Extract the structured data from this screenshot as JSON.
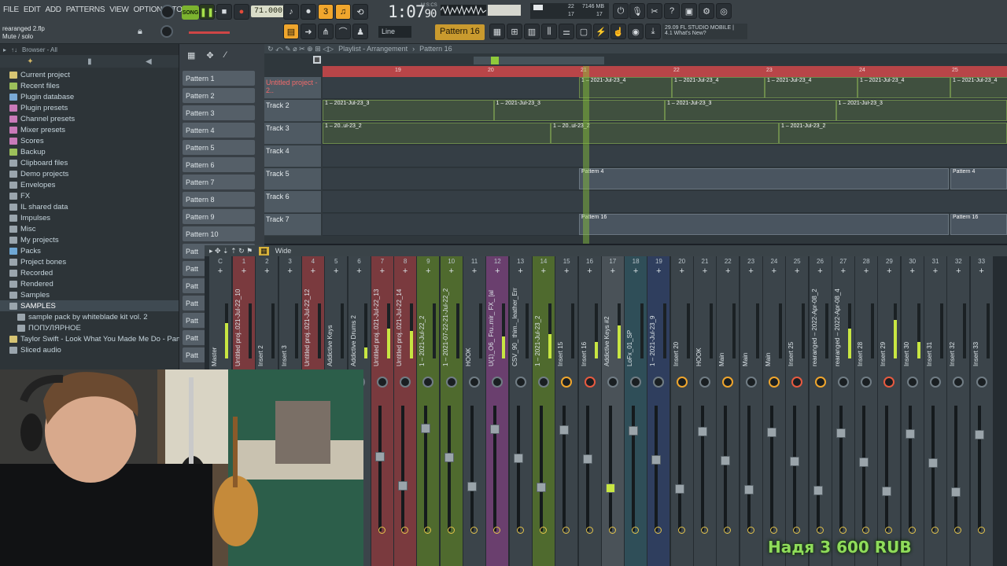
{
  "menu": [
    "FILE",
    "EDIT",
    "ADD",
    "PATTERNS",
    "VIEW",
    "OPTIONS",
    "TOOLS",
    "HELP"
  ],
  "transport": {
    "mode": "SONG",
    "tempo": "71.000",
    "time": "1:07",
    "time_sub": "90",
    "time_label": "M:S:CS",
    "cpu_top": "22",
    "cpu_bottom": "17",
    "ram": "7146 MB",
    "ram_sub": "17"
  },
  "hint": {
    "file": "rearanged 2.flp",
    "action": "Mute / solo"
  },
  "snap": "Line",
  "pattern_selector": "Pattern 16",
  "news": {
    "date": "29.09",
    "title": "FL STUDIO MOBILE |",
    "subtitle": "4.1 What's New?"
  },
  "browser": {
    "header": "Browser - All",
    "items": [
      {
        "label": "Current project",
        "color": "#d6c473"
      },
      {
        "label": "Recent files",
        "color": "#9cc05a"
      },
      {
        "label": "Plugin database",
        "color": "#7aa9d6"
      },
      {
        "label": "Plugin presets",
        "color": "#c97ab9"
      },
      {
        "label": "Channel presets",
        "color": "#c97ab9"
      },
      {
        "label": "Mixer presets",
        "color": "#c97ab9"
      },
      {
        "label": "Scores",
        "color": "#c97ab9"
      },
      {
        "label": "Backup",
        "color": "#9cc05a"
      },
      {
        "label": "Clipboard files",
        "color": "#9aa5ad"
      },
      {
        "label": "Demo projects",
        "color": "#9aa5ad"
      },
      {
        "label": "Envelopes",
        "color": "#9aa5ad"
      },
      {
        "label": "FX",
        "color": "#9aa5ad"
      },
      {
        "label": "IL shared data",
        "color": "#9aa5ad"
      },
      {
        "label": "Impulses",
        "color": "#9aa5ad"
      },
      {
        "label": "Misc",
        "color": "#9aa5ad"
      },
      {
        "label": "My projects",
        "color": "#9aa5ad"
      },
      {
        "label": "Packs",
        "color": "#6fa8d6"
      },
      {
        "label": "Project bones",
        "color": "#9aa5ad"
      },
      {
        "label": "Recorded",
        "color": "#9aa5ad"
      },
      {
        "label": "Rendered",
        "color": "#9aa5ad"
      },
      {
        "label": "Samples",
        "color": "#9aa5ad"
      },
      {
        "label": "SAMPLES",
        "color": "#9aa5ad"
      },
      {
        "label": "sample pack by whiteblade kit vol. 2",
        "color": "#9aa5ad"
      },
      {
        "label": "ПОПУЛЯРНОЕ",
        "color": "#9aa5ad"
      },
      {
        "label": "Taylor Swift - Look What You Made Me Do - Part_1",
        "color": "#d6c473"
      },
      {
        "label": "Sliced audio",
        "color": "#9aa5ad"
      }
    ]
  },
  "patterns": [
    "Pattern 1",
    "Pattern 2",
    "Pattern 3",
    "Pattern 4",
    "Pattern 5",
    "Pattern 6",
    "Pattern 7",
    "Pattern 8",
    "Pattern 9",
    "Pattern 10",
    "Patt",
    "Patt",
    "Patt",
    "Patt",
    "Patt",
    "Patt",
    "Patt"
  ],
  "playlist": {
    "title": "Playlist - Arrangement",
    "pattern": "Pattern 16",
    "bars": [
      "19",
      "20",
      "21",
      "22",
      "23",
      "24",
      "25"
    ],
    "tracks": [
      {
        "label": "Untitled project - 2..",
        "clips": [
          "1 – 2021-Jul-23_4",
          "1 – 2021-Jul-23_4",
          "1 – 2021-Jul-23_4",
          "1 – 2021-Jul-23_4",
          "1 – 2021-Jul-23_4"
        ]
      },
      {
        "label": "Track 2",
        "clips": [
          "1 – 2021-Jul-23_3",
          "1 – 2021-Jul-23_3",
          "1 – 2021-Jul-23_3",
          "1 – 2021-Jul-23_3"
        ]
      },
      {
        "label": "Track 3",
        "clips": [
          "1 – 20..ul-23_2",
          "1 – 20..ul-23_2",
          "1 – 2021-Jul-23_2"
        ]
      },
      {
        "label": "Track 4",
        "clips": []
      },
      {
        "label": "Track 5",
        "clips": [
          "Pattern 4",
          "Pattern 4"
        ]
      },
      {
        "label": "Track 6",
        "clips": []
      },
      {
        "label": "Track 7",
        "clips": [
          "Pattern 16",
          "Pattern 16"
        ]
      }
    ]
  },
  "mixer": {
    "preset": "Wide",
    "channels": [
      {
        "num": "C",
        "name": "Master",
        "level": 0.65,
        "color": "#3b444a"
      },
      {
        "num": "1",
        "name": "Untitled proj..021-Jul-22_10",
        "level": 0.0,
        "color": "#7a3a3e"
      },
      {
        "num": "2",
        "name": "Insert 2",
        "level": 0.0,
        "color": "#3b444a"
      },
      {
        "num": "3",
        "name": "Insert 3",
        "level": 0.0,
        "color": "#3b444a"
      },
      {
        "num": "4",
        "name": "Untitled proj..021-Jul-22_12",
        "level": 0.0,
        "color": "#7a3a3e"
      },
      {
        "num": "5",
        "name": "Addictive Keys",
        "level": 0.0,
        "color": "#3b444a"
      },
      {
        "num": "6",
        "name": "Addictive Drums 2",
        "level": 0.2,
        "color": "#3b444a"
      },
      {
        "num": "7",
        "name": "Untitled proj..021-Jul-22_13",
        "level": 0.55,
        "color": "#7a3a3e"
      },
      {
        "num": "8",
        "name": "Untitled proj..021-Jul-22_14",
        "level": 0.5,
        "color": "#7a3a3e"
      },
      {
        "num": "9",
        "name": "1 – 2021-Jul-22_2",
        "level": 0.0,
        "color": "#4f6a2e"
      },
      {
        "num": "10",
        "name": "1 – 2021-07-22-21-Jul-22_2",
        "level": 0.0,
        "color": "#4f6a2e"
      },
      {
        "num": "11",
        "name": "HOOK",
        "level": 0.0,
        "color": "#3b444a"
      },
      {
        "num": "12",
        "name": "U(1)_O6_ Fru..mir_ FX_ [al",
        "level": 0.4,
        "color": "#6a3f6e"
      },
      {
        "num": "13",
        "name": "CSV_90_ thim.._leather_Em",
        "level": 0.0,
        "color": "#3b444a"
      },
      {
        "num": "14",
        "name": "1 – 2021-Jul-23_2",
        "level": 0.45,
        "color": "#4f6a2e"
      },
      {
        "num": "15",
        "name": "Insert 15",
        "level": 0.0,
        "color": "#3b444a"
      },
      {
        "num": "16",
        "name": "Insert 16",
        "level": 0.3,
        "color": "#3b444a"
      },
      {
        "num": "17",
        "name": "Addictive Keys #2",
        "level": 0.6,
        "color": "#4a5258"
      },
      {
        "num": "18",
        "name": "LoFx_01_SP",
        "level": 0.0,
        "color": "#2f4e58"
      },
      {
        "num": "19",
        "name": "1 – 2021-Jul-23_9",
        "level": 0.0,
        "color": "#2f3e5e"
      },
      {
        "num": "20",
        "name": "Insert 20",
        "level": 0.0,
        "color": "#3b444a"
      },
      {
        "num": "21",
        "name": "HOOK",
        "level": 0.0,
        "color": "#3b444a"
      },
      {
        "num": "22",
        "name": "Main",
        "level": 0.0,
        "color": "#3b444a"
      },
      {
        "num": "23",
        "name": "Main",
        "level": 0.0,
        "color": "#3b444a"
      },
      {
        "num": "24",
        "name": "Main",
        "level": 0.0,
        "color": "#3b444a"
      },
      {
        "num": "25",
        "name": "Insert 25",
        "level": 0.0,
        "color": "#3b444a"
      },
      {
        "num": "26",
        "name": "rearanged – 2022-Apr-08_2",
        "level": 0.0,
        "color": "#3b444a"
      },
      {
        "num": "27",
        "name": "rearanged – 2022-Apr-08_4",
        "level": 0.55,
        "color": "#3b444a"
      },
      {
        "num": "28",
        "name": "Insert 28",
        "level": 0.0,
        "color": "#3b444a"
      },
      {
        "num": "29",
        "name": "Insert 29",
        "level": 0.7,
        "color": "#3b444a"
      },
      {
        "num": "30",
        "name": "Insert 30",
        "level": 0.3,
        "color": "#3b444a"
      },
      {
        "num": "31",
        "name": "Insert 31",
        "level": 0.0,
        "color": "#3b444a"
      },
      {
        "num": "32",
        "name": "Insert 32",
        "level": 0.0,
        "color": "#3b444a"
      },
      {
        "num": "33",
        "name": "Insert 33",
        "level": 0.0,
        "color": "#3b444a"
      }
    ]
  },
  "donation": "Надя 3 600 RUB"
}
